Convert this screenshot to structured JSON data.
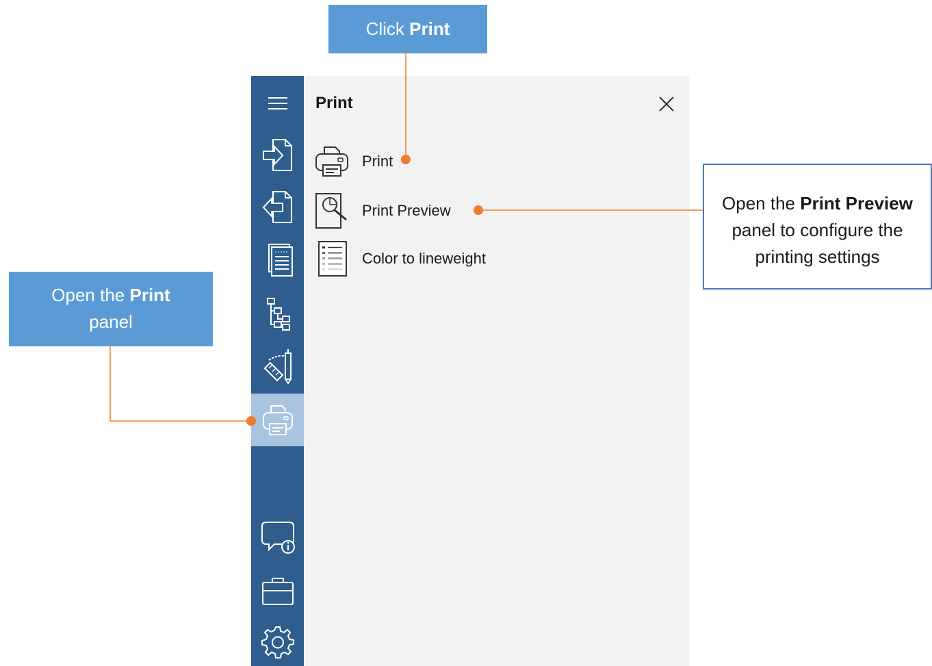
{
  "panel": {
    "title": "Print",
    "close_icon": "close-icon",
    "items": [
      {
        "label": "Print",
        "icon": "printer-icon"
      },
      {
        "label": "Print Preview",
        "icon": "print-preview-icon"
      },
      {
        "label": "Color to lineweight",
        "icon": "list-icon"
      }
    ]
  },
  "sidebar": {
    "items": [
      {
        "icon": "hamburger-menu-icon"
      },
      {
        "icon": "import-icon"
      },
      {
        "icon": "export-icon"
      },
      {
        "icon": "document-icon"
      },
      {
        "icon": "tree-icon"
      },
      {
        "icon": "measure-tools-icon"
      },
      {
        "icon": "printer-icon",
        "active": true
      },
      {
        "icon": "comment-info-icon"
      },
      {
        "icon": "briefcase-icon"
      },
      {
        "icon": "gear-icon"
      }
    ]
  },
  "callouts": {
    "click_print": {
      "pre": "Click ",
      "bold": "Print"
    },
    "open_panel": {
      "pre": "Open the ",
      "bold": "Print",
      "post": "panel"
    },
    "preview": {
      "pre": "Open the ",
      "bold": "Print Preview",
      "line2": "panel to configure the",
      "line3": "printing settings"
    }
  },
  "colors": {
    "sidebar": "#2f5e8e",
    "sidebar_active": "#a9c4df",
    "panel_bg": "#f2f2f2",
    "callout_fill": "#5b9bd5",
    "callout_border": "#4a78b5",
    "leader_line": "#ed7d31"
  }
}
